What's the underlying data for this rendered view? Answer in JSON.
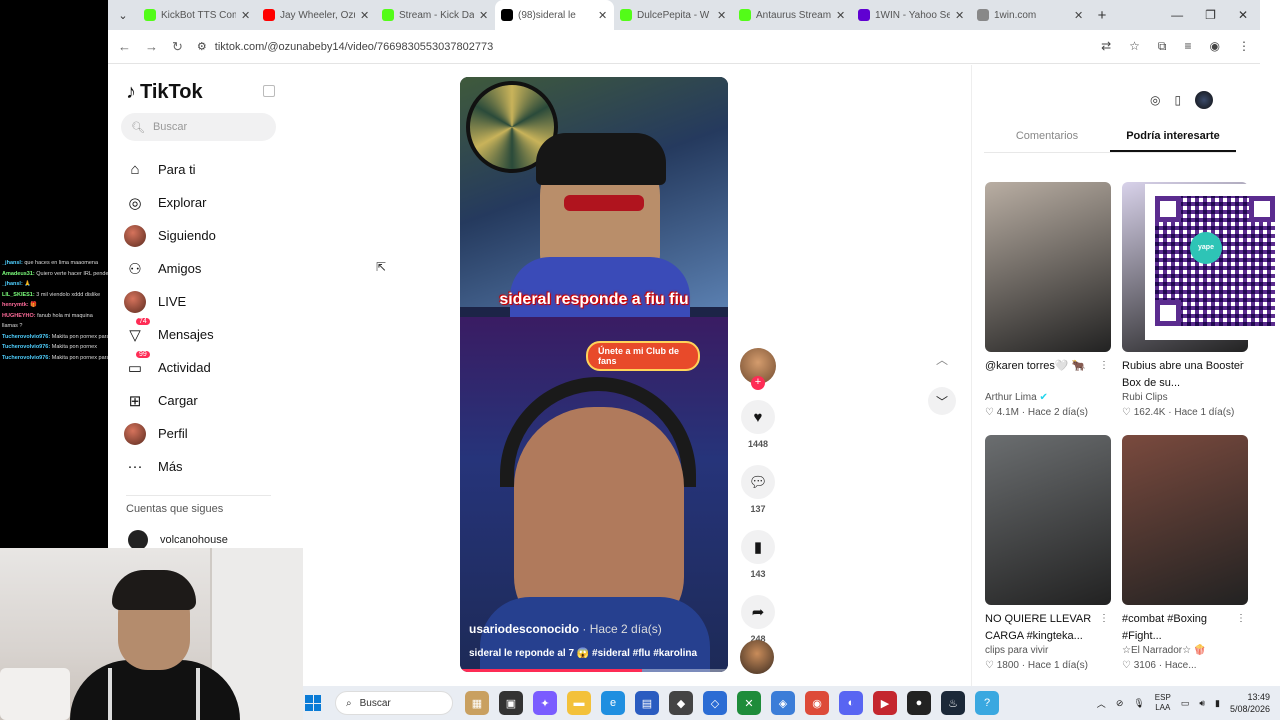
{
  "browser": {
    "tabs": [
      {
        "title": "KickBot TTS Com",
        "favicon_color": "#53fc18",
        "active": false
      },
      {
        "title": "Jay Wheeler, Ozu",
        "favicon_color": "#ff0000",
        "active": false
      },
      {
        "title": "Stream - Kick Da",
        "favicon_color": "#53fc18",
        "active": false
      },
      {
        "title": "(98)sideral le",
        "favicon_color": "#000000",
        "active": true
      },
      {
        "title": "DulcePepita - W",
        "favicon_color": "#53fc18",
        "active": false
      },
      {
        "title": "Antaurus Stream",
        "favicon_color": "#53fc18",
        "active": false
      },
      {
        "title": "1WIN - Yahoo Se",
        "favicon_color": "#6001d2",
        "active": false
      },
      {
        "title": "1win.com",
        "favicon_color": "#888888",
        "active": false
      }
    ],
    "url": "tiktok.com/@ozunabeby14/video/7669830553037802773"
  },
  "chat": [
    {
      "user": "_jhansl:",
      "msg": "que haces en lima maaomena",
      "cls": "u1"
    },
    {
      "user": "Amadeus31:",
      "msg": "Quiero verte hacer IRL pendejos",
      "cls": "u2"
    },
    {
      "user": "_jhansl:",
      "msg": "🙏",
      "cls": "u1"
    },
    {
      "user": "LIL_SKIES1:",
      "msg": "3 mil viendolo xddd dislike",
      "cls": "u2"
    },
    {
      "user": "henrymtk:",
      "msg": "🎁",
      "cls": "u3"
    },
    {
      "user": "HUGHEYHO:",
      "msg": "fanub hola mi maquina",
      "cls": "u3"
    },
    {
      "user": "",
      "msg": "llamas ?",
      "cls": ""
    },
    {
      "user": "Tucherovolvio976:",
      "msg": "Makita pon pornex para la",
      "cls": "u1"
    },
    {
      "user": "Tucherovolvio976:",
      "msg": "Makita pon pornex",
      "cls": "u1"
    },
    {
      "user": "Tucherovolvio976:",
      "msg": "Makita pon pornex para la",
      "cls": "u1"
    }
  ],
  "tiktok": {
    "logo": "TikTok",
    "search_placeholder": "Buscar",
    "menu": [
      {
        "label": "Para ti",
        "icon": "home-icon",
        "glyph": "⌂"
      },
      {
        "label": "Explorar",
        "icon": "compass-icon",
        "glyph": "◎"
      },
      {
        "label": "Siguiendo",
        "icon": "following-avatar",
        "glyph": ""
      },
      {
        "label": "Amigos",
        "icon": "friends-icon",
        "glyph": "⚇"
      },
      {
        "label": "LIVE",
        "icon": "live-icon",
        "glyph": ""
      },
      {
        "label": "Mensajes",
        "icon": "messages-icon",
        "glyph": "▽",
        "badge": "74"
      },
      {
        "label": "Actividad",
        "icon": "activity-icon",
        "glyph": "▭",
        "badge": "99"
      },
      {
        "label": "Cargar",
        "icon": "upload-icon",
        "glyph": "⊞"
      },
      {
        "label": "Perfil",
        "icon": "profile-avatar",
        "glyph": ""
      },
      {
        "label": "Más",
        "icon": "more-icon",
        "glyph": "···"
      }
    ],
    "following_title": "Cuentas que sigues",
    "following": [
      {
        "name": "volcanohouse"
      }
    ]
  },
  "video": {
    "caption_overlay": "sideral responde a fiu fiu",
    "club_button": "Únete a mi Club de fans",
    "author": "usariodesconocido",
    "time_ago": "· Hace 2 día(s)",
    "description": "sideral le reponde al 7 😱 #sideral #flu #karolina",
    "progress": 0.68
  },
  "actions": {
    "likes": "1448",
    "comments": "137",
    "saves": "143",
    "shares": "248"
  },
  "right_panel": {
    "tabs": [
      {
        "label": "Comentarios",
        "active": false
      },
      {
        "label": "Podría interesarte",
        "active": true
      }
    ],
    "cards": [
      {
        "title": "@karen torres🤍 🐂",
        "author": "Arthur Lima",
        "verified": true,
        "views": "4.1M",
        "ago": "Hace 2 día(s)",
        "thumb": "#b9aea3"
      },
      {
        "title": "Rubius abre una Booster Box de su...",
        "author": "Rubi Clips",
        "verified": false,
        "views": "162.4K",
        "ago": "Hace 1 día(s)",
        "thumb": "#d8d2ea"
      },
      {
        "title": "NO QUIERE LLEVAR CARGA #kingteka...",
        "author": "clips para vivir",
        "verified": false,
        "views": "1800",
        "ago": "Hace 1 día(s)",
        "thumb": "#6b6e70"
      },
      {
        "title": "#combat #Boxing #Fight...",
        "author": "☆El Narrador☆ 🍿",
        "verified": false,
        "views": "3106",
        "ago": "Hace...",
        "thumb": "#7a4a3e"
      }
    ],
    "qr_label": "yape"
  },
  "taskbar": {
    "search": "Buscar",
    "lang_1": "ESP",
    "lang_2": "LAA",
    "time": "13:49",
    "date": "5/08/2026"
  }
}
